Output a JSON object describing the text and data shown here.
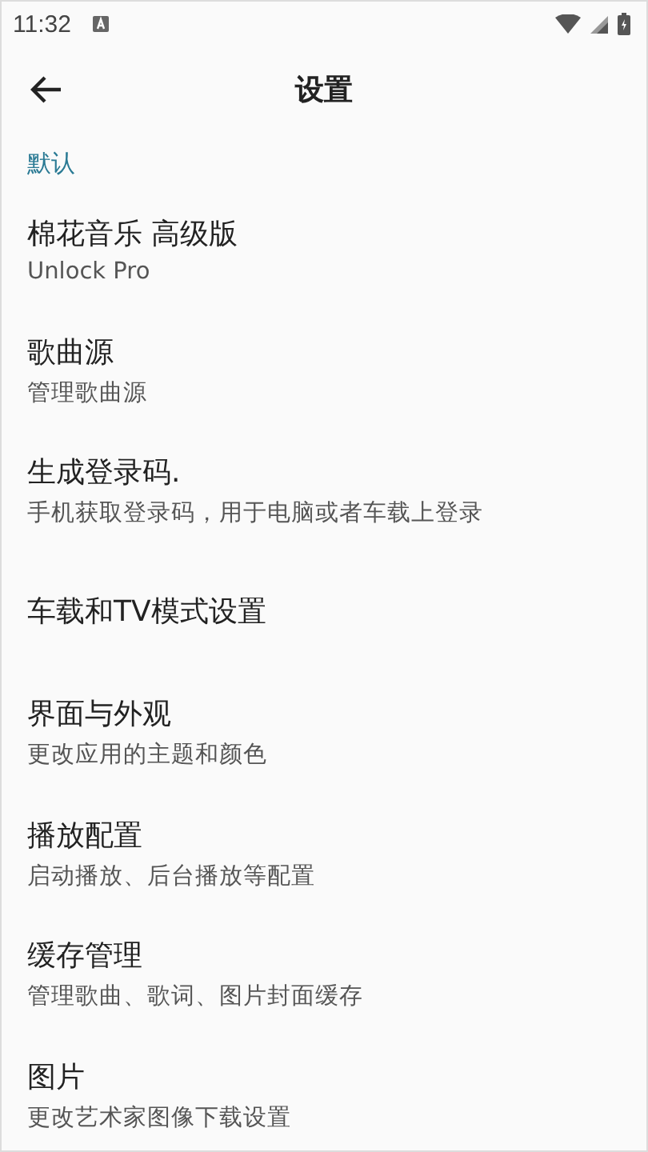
{
  "status_bar": {
    "time": "11:32"
  },
  "app_bar": {
    "title": "设置"
  },
  "section": {
    "title": "默认"
  },
  "items": [
    {
      "title": "棉花音乐 高级版",
      "subtitle": "Unlock Pro"
    },
    {
      "title": "歌曲源",
      "subtitle": "管理歌曲源"
    },
    {
      "title": "生成登录码.",
      "subtitle": "手机获取登录码，用于电脑或者车载上登录"
    },
    {
      "title": "车载和TV模式设置"
    },
    {
      "title": "界面与外观",
      "subtitle": "更改应用的主题和颜色"
    },
    {
      "title": "播放配置",
      "subtitle": "启动播放、后台播放等配置"
    },
    {
      "title": "缓存管理",
      "subtitle": "管理歌曲、歌词、图片封面缓存"
    },
    {
      "title": "图片",
      "subtitle": "更改艺术家图像下载设置"
    }
  ]
}
